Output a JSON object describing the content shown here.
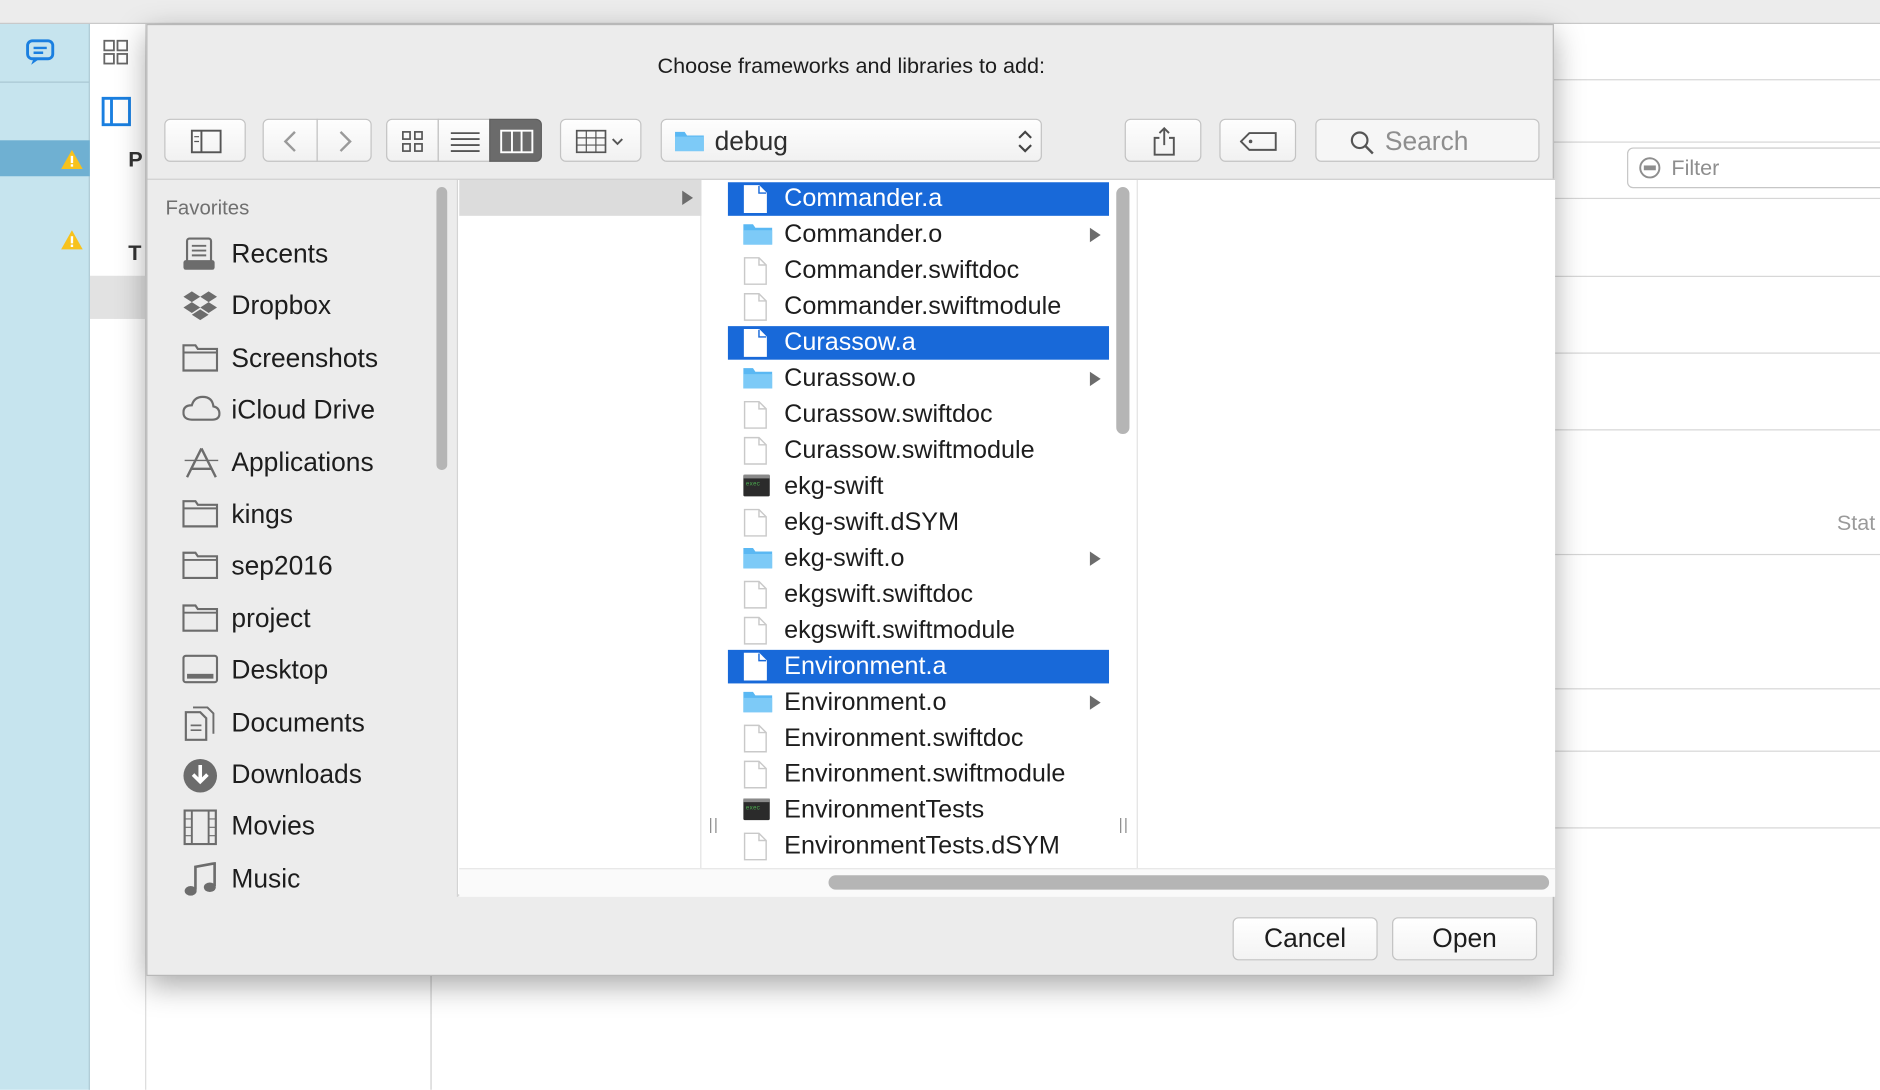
{
  "dialog": {
    "title": "Choose frameworks and libraries to add:",
    "current_folder": "debug",
    "search_placeholder": "Search",
    "cancel_label": "Cancel",
    "open_label": "Open"
  },
  "sidebar": {
    "section_header": "Favorites",
    "items": [
      {
        "label": "Recents",
        "icon": "recents-icon"
      },
      {
        "label": "Dropbox",
        "icon": "dropbox-icon"
      },
      {
        "label": "Screenshots",
        "icon": "folder-icon"
      },
      {
        "label": "iCloud Drive",
        "icon": "cloud-icon"
      },
      {
        "label": "Applications",
        "icon": "applications-icon"
      },
      {
        "label": "kings",
        "icon": "folder-icon"
      },
      {
        "label": "sep2016",
        "icon": "folder-icon"
      },
      {
        "label": "project",
        "icon": "folder-icon"
      },
      {
        "label": "Desktop",
        "icon": "desktop-icon"
      },
      {
        "label": "Documents",
        "icon": "documents-icon"
      },
      {
        "label": "Downloads",
        "icon": "downloads-icon"
      },
      {
        "label": "Movies",
        "icon": "movies-icon"
      },
      {
        "label": "Music",
        "icon": "music-icon"
      }
    ]
  },
  "files": [
    {
      "name": "Commander.a",
      "kind": "document",
      "selected": true
    },
    {
      "name": "Commander.o",
      "kind": "folder",
      "selected": false
    },
    {
      "name": "Commander.swiftdoc",
      "kind": "document",
      "selected": false
    },
    {
      "name": "Commander.swiftmodule",
      "kind": "document",
      "selected": false
    },
    {
      "name": "Curassow.a",
      "kind": "document",
      "selected": true
    },
    {
      "name": "Curassow.o",
      "kind": "folder",
      "selected": false
    },
    {
      "name": "Curassow.swiftdoc",
      "kind": "document",
      "selected": false
    },
    {
      "name": "Curassow.swiftmodule",
      "kind": "document",
      "selected": false
    },
    {
      "name": "ekg-swift",
      "kind": "executable",
      "selected": false
    },
    {
      "name": "ekg-swift.dSYM",
      "kind": "document",
      "selected": false
    },
    {
      "name": "ekg-swift.o",
      "kind": "folder",
      "selected": false
    },
    {
      "name": "ekgswift.swiftdoc",
      "kind": "document",
      "selected": false
    },
    {
      "name": "ekgswift.swiftmodule",
      "kind": "document",
      "selected": false
    },
    {
      "name": "Environment.a",
      "kind": "document",
      "selected": true
    },
    {
      "name": "Environment.o",
      "kind": "folder",
      "selected": false
    },
    {
      "name": "Environment.swiftdoc",
      "kind": "document",
      "selected": false
    },
    {
      "name": "Environment.swiftmodule",
      "kind": "document",
      "selected": false
    },
    {
      "name": "EnvironmentTests",
      "kind": "executable",
      "selected": false
    },
    {
      "name": "EnvironmentTests.dSYM",
      "kind": "document",
      "selected": false
    }
  ],
  "background": {
    "filter_placeholder": "Filter",
    "status_partial": "Stat",
    "label_p": "P",
    "label_t": "T"
  },
  "colors": {
    "selection": "#1869d9",
    "folder": "#5ab8f3",
    "warning": "#f7c21c"
  }
}
